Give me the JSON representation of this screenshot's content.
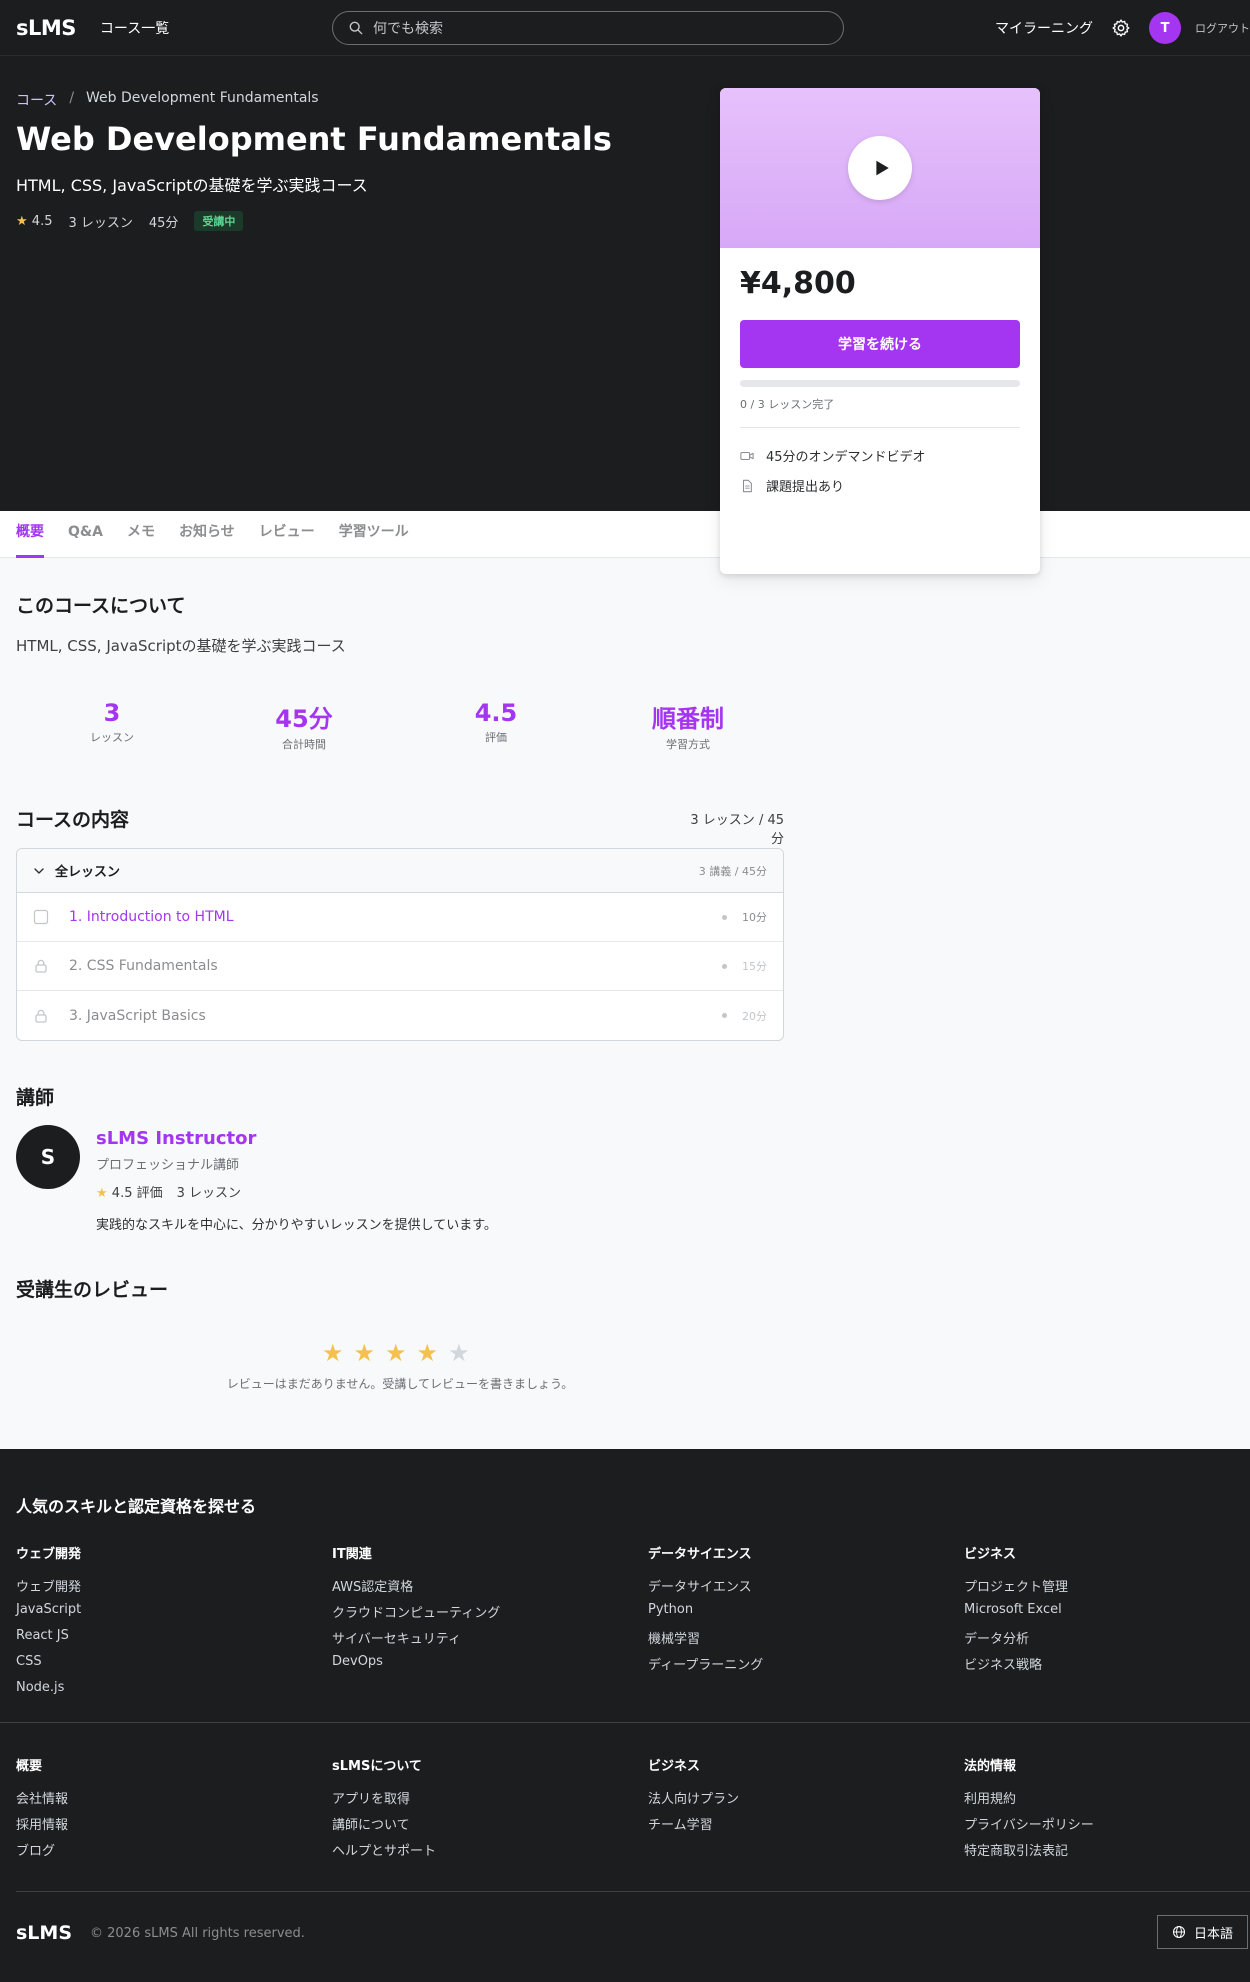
{
  "header": {
    "logo": "sLMS",
    "nav_courses": "コース一覧",
    "search_placeholder": "何でも検索",
    "my_learning": "マイラーニング",
    "avatar_letter": "T",
    "logout": "ログアウト"
  },
  "hero": {
    "breadcrumb_root": "コース",
    "breadcrumb_sep": "/",
    "breadcrumb_current": "Web Development Fundamentals",
    "title": "Web Development Fundamentals",
    "subtitle": "HTML, CSS, JavaScriptの基礎を学ぶ実践コース",
    "rating": "4.5",
    "lessons": "3 レッスン",
    "duration": "45分",
    "status_badge": "受講中"
  },
  "tabs": [
    {
      "label": "概要",
      "active": true
    },
    {
      "label": "Q&A"
    },
    {
      "label": "メモ"
    },
    {
      "label": "お知らせ"
    },
    {
      "label": "レビュー"
    },
    {
      "label": "学習ツール"
    }
  ],
  "about": {
    "title": "このコースについて",
    "description": "HTML, CSS, JavaScriptの基礎を学ぶ実践コース",
    "stats": [
      {
        "value": "3",
        "label": "レッスン"
      },
      {
        "value": "45分",
        "label": "合計時間"
      },
      {
        "value": "4.5",
        "label": "評価"
      },
      {
        "value": "順番制",
        "label": "学習方式"
      }
    ]
  },
  "content": {
    "title": "コースの内容",
    "summary": "3 レッスン / 45分",
    "section_title": "全レッスン",
    "section_count": "3 講義 / 45分",
    "lessons": [
      {
        "title": "1. Introduction to HTML",
        "duration": "10分",
        "state": "open"
      },
      {
        "title": "2. CSS Fundamentals",
        "duration": "15分",
        "state": "locked"
      },
      {
        "title": "3. JavaScript Basics",
        "duration": "20分",
        "state": "locked"
      }
    ]
  },
  "instructor": {
    "section_title": "講師",
    "initial": "S",
    "name": "sLMS Instructor",
    "role": "プロフェッショナル講師",
    "rating": "4.5 評価",
    "lessons": "3 レッスン",
    "bio": "実践的なスキルを中心に、分かりやすいレッスンを提供しています。"
  },
  "reviews": {
    "title": "受講生のレビュー",
    "stars_filled": 4,
    "stars_total": 5,
    "empty_message": "レビューはまだありません。受講してレビューを書きましょう。"
  },
  "card": {
    "price": "¥4,800",
    "cta": "学習を続ける",
    "progress_fraction": 0,
    "progress_text": "0 / 3 レッスン完了",
    "features": [
      "45分のオンデマンドビデオ",
      "課題提出あり"
    ]
  },
  "footer": {
    "title": "人気のスキルと認定資格を探せる",
    "skill_columns": [
      {
        "heading": "ウェブ開発",
        "items": [
          "ウェブ開発",
          "JavaScript",
          "React JS",
          "CSS",
          "Node.js"
        ]
      },
      {
        "heading": "IT関連",
        "items": [
          "AWS認定資格",
          "クラウドコンピューティング",
          "サイバーセキュリティ",
          "DevOps"
        ]
      },
      {
        "heading": "データサイエンス",
        "items": [
          "データサイエンス",
          "Python",
          "機械学習",
          "ディープラーニング"
        ]
      },
      {
        "heading": "ビジネス",
        "items": [
          "プロジェクト管理",
          "Microsoft Excel",
          "データ分析",
          "ビジネス戦略"
        ]
      }
    ],
    "link_columns": [
      {
        "heading": "概要",
        "items": [
          "会社情報",
          "採用情報",
          "ブログ"
        ]
      },
      {
        "heading": "sLMSについて",
        "items": [
          "アプリを取得",
          "講師について",
          "ヘルプとサポート"
        ]
      },
      {
        "heading": "ビジネス",
        "items": [
          "法人向けプラン",
          "チーム学習"
        ]
      },
      {
        "heading": "法的情報",
        "items": [
          "利用規約",
          "プライバシーポリシー",
          "特定商取引法表記"
        ]
      }
    ],
    "logo": "sLMS",
    "copyright": "© 2026 sLMS All rights reserved.",
    "language": "日本語"
  }
}
